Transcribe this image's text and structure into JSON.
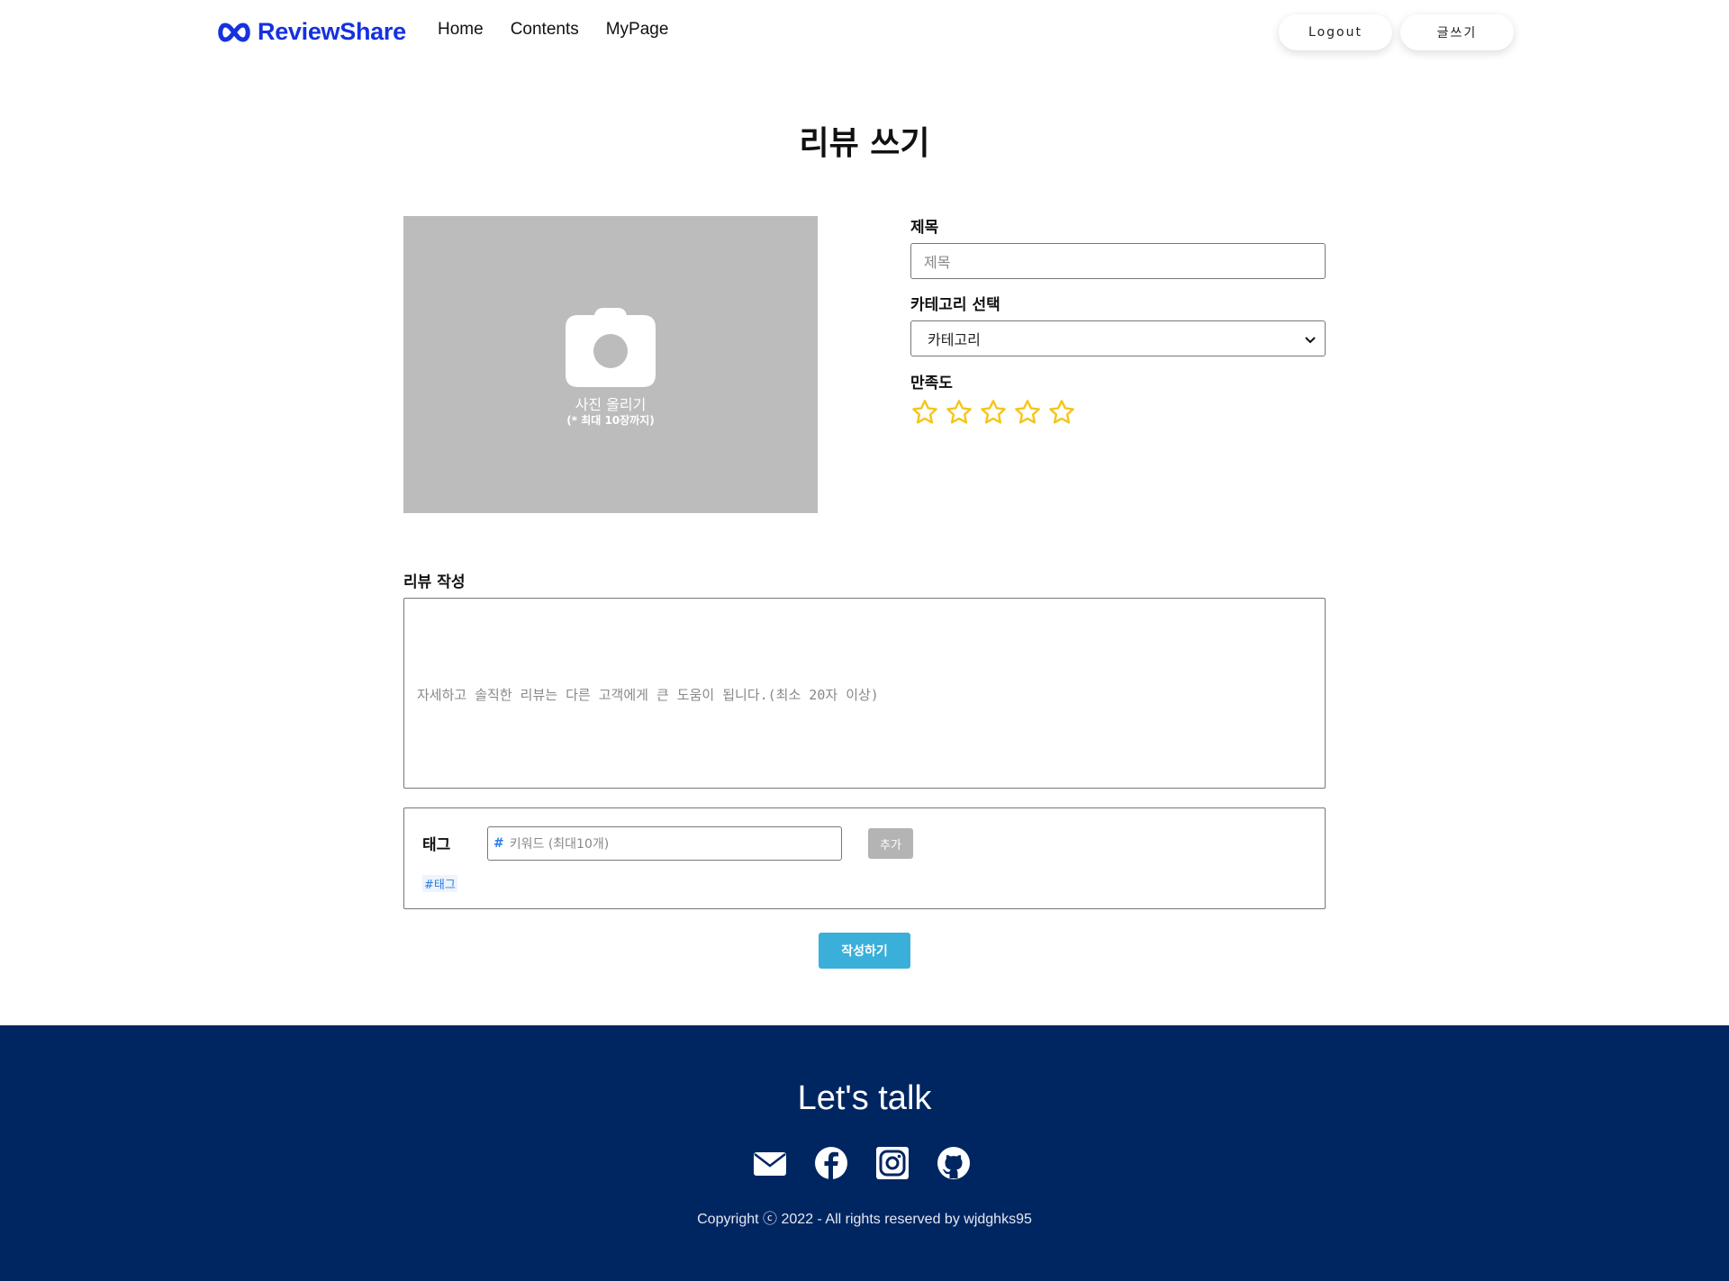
{
  "header": {
    "logo_text": "ReviewShare",
    "nav": [
      "Home",
      "Contents",
      "MyPage"
    ],
    "logout_label": "Logout",
    "write_label": "글쓰기"
  },
  "page_title": "리뷰 쓰기",
  "photo": {
    "label": "사진 올리기",
    "sublabel": "(* 최대 10장까지)",
    "icon": "camera-icon"
  },
  "form": {
    "title_label": "제목",
    "title_placeholder": "제목",
    "category_label": "카테고리 선택",
    "category_selected": "카테고리",
    "rating_label": "만족도",
    "rating_value": 0,
    "rating_max": 5,
    "star_color": "#f5c518"
  },
  "review": {
    "label": "리뷰 작성",
    "placeholder": "자세하고 솔직한 리뷰는 다른 고객에게 큰 도움이 됩니다.(최소 20자 이상)"
  },
  "tags": {
    "label": "태그",
    "hash": "#",
    "input_placeholder": "키워드 (최대10개)",
    "add_label": "추가",
    "chip": "#태그"
  },
  "submit_label": "작성하기",
  "footer": {
    "title": "Let's talk",
    "icons": [
      "mail-icon",
      "facebook-icon",
      "instagram-icon",
      "github-icon"
    ],
    "copyright": "Copyright ⓒ 2022 - All rights reserved by wjdghks95"
  },
  "colors": {
    "brand": "#1531e0",
    "footer_bg": "#002662",
    "submit": "#3aafd9",
    "tag_accent": "#2a7de1"
  }
}
